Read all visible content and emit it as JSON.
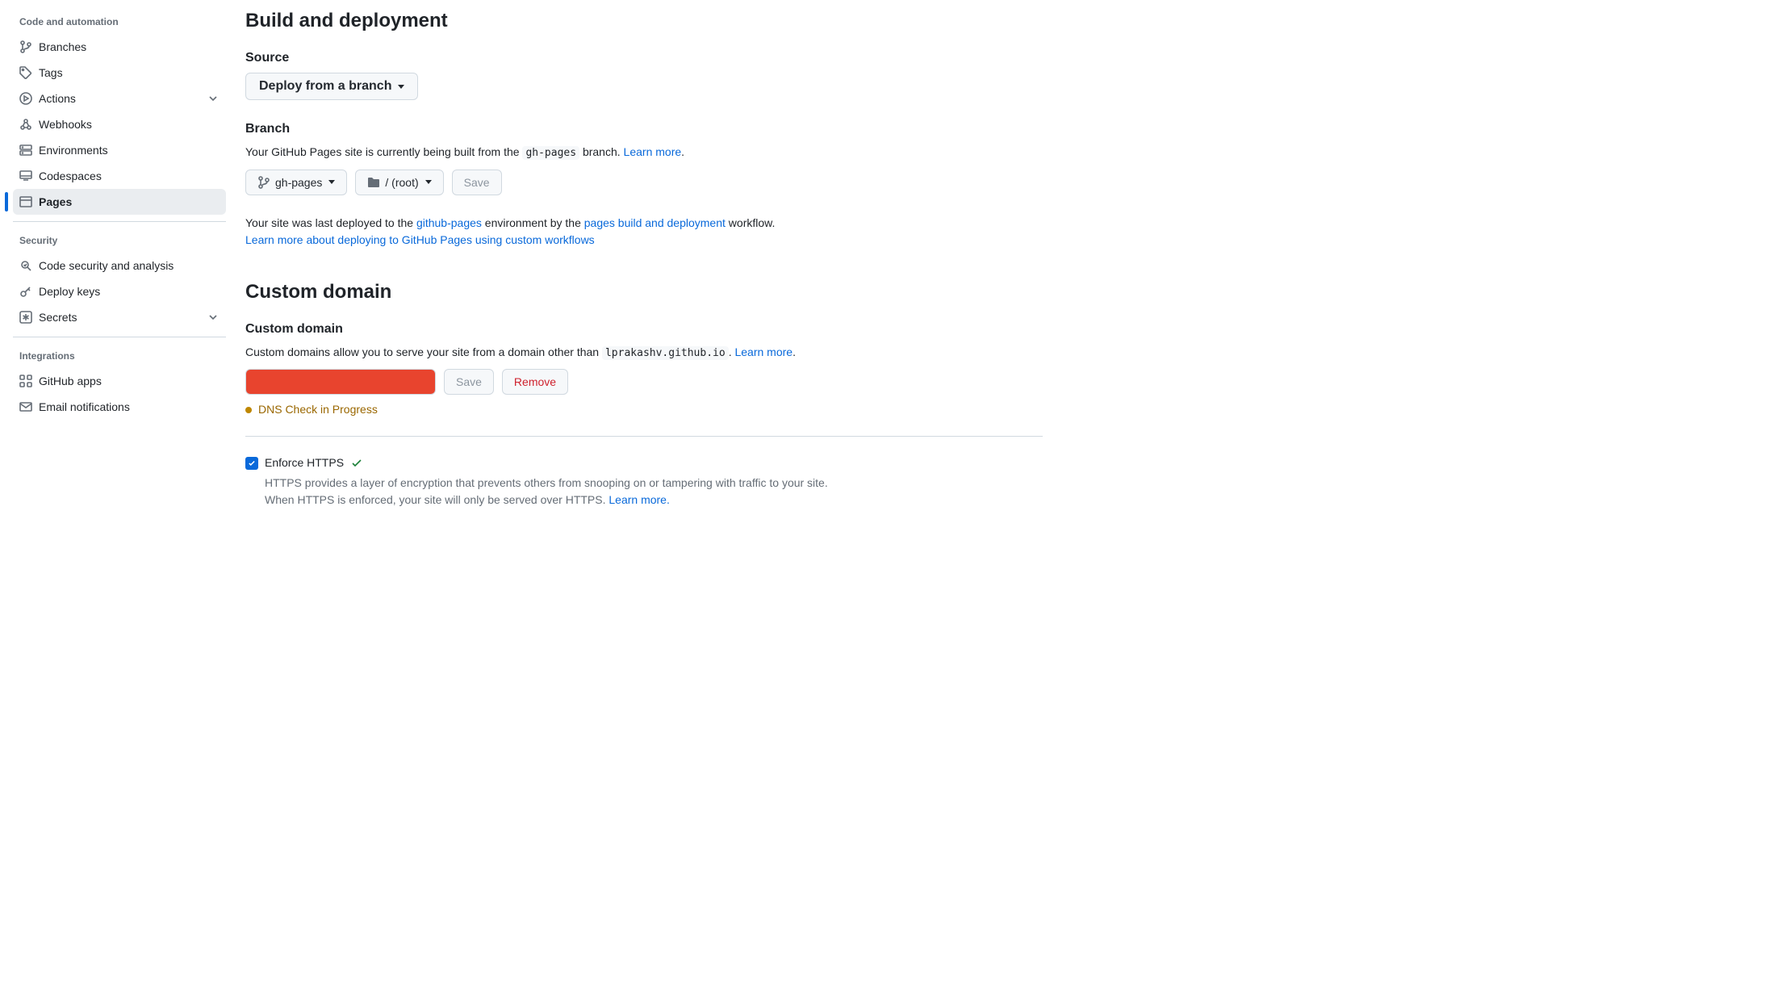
{
  "sidebar": {
    "group1_title": "Code and automation",
    "items1": [
      {
        "id": "branches",
        "label": "Branches"
      },
      {
        "id": "tags",
        "label": "Tags"
      },
      {
        "id": "actions",
        "label": "Actions",
        "expandable": true
      },
      {
        "id": "webhooks",
        "label": "Webhooks"
      },
      {
        "id": "environments",
        "label": "Environments"
      },
      {
        "id": "codespaces",
        "label": "Codespaces"
      },
      {
        "id": "pages",
        "label": "Pages",
        "active": true
      }
    ],
    "group2_title": "Security",
    "items2": [
      {
        "id": "code-security",
        "label": "Code security and analysis"
      },
      {
        "id": "deploy-keys",
        "label": "Deploy keys"
      },
      {
        "id": "secrets",
        "label": "Secrets",
        "expandable": true
      }
    ],
    "group3_title": "Integrations",
    "items3": [
      {
        "id": "github-apps",
        "label": "GitHub apps"
      },
      {
        "id": "email-notifications",
        "label": "Email notifications"
      }
    ]
  },
  "build": {
    "heading": "Build and deployment",
    "source_label": "Source",
    "source_value": "Deploy from a branch",
    "branch_label": "Branch",
    "branch_desc_prefix": "Your GitHub Pages site is currently being built from the ",
    "branch_code": "gh-pages",
    "branch_desc_suffix": " branch. ",
    "learn_more": "Learn more",
    "branch_picker_value": "gh-pages",
    "folder_picker_value": "/ (root)",
    "save_label": "Save",
    "deploy_text_prefix": "Your site was last deployed to the ",
    "deploy_env_link": "github-pages",
    "deploy_text_mid": " environment by the ",
    "deploy_workflow_link": "pages build and deployment",
    "deploy_text_suffix": " workflow.",
    "deploy_learn_link": "Learn more about deploying to GitHub Pages using custom workflows"
  },
  "custom_domain": {
    "heading": "Custom domain",
    "label": "Custom domain",
    "desc_prefix": "Custom domains allow you to serve your site from a domain other than ",
    "domain_code": "lprakashv.github.io",
    "desc_suffix": ". ",
    "learn_more": "Learn more",
    "input_value": "",
    "save_label": "Save",
    "remove_label": "Remove",
    "status_text": "DNS Check in Progress"
  },
  "https": {
    "label": "Enforce HTTPS",
    "desc_line1": "HTTPS provides a layer of encryption that prevents others from snooping on or tampering with traffic to your site.",
    "desc_line2_prefix": "When HTTPS is enforced, your site will only be served over HTTPS. ",
    "learn_more": "Learn more."
  }
}
